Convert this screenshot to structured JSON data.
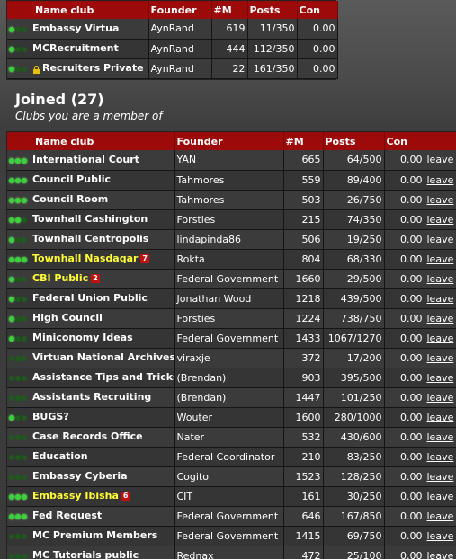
{
  "owned": {
    "headers": {
      "name": "Name club",
      "founder": "Founder",
      "members": "#M",
      "posts": "Posts",
      "con": "Con"
    },
    "rows": [
      {
        "dots": 3,
        "lit": 1,
        "name": "Embassy Virtua",
        "founder": "AynRand",
        "members": "619",
        "posts": "11/350",
        "con": "0.00",
        "lock": false
      },
      {
        "dots": 3,
        "lit": 1,
        "name": "MCRecruitment",
        "founder": "AynRand",
        "members": "444",
        "posts": "112/350",
        "con": "0.00",
        "lock": false
      },
      {
        "dots": 3,
        "lit": 1,
        "name": "Recruiters Private",
        "founder": "AynRand",
        "members": "22",
        "posts": "161/350",
        "con": "0.00",
        "lock": true
      }
    ]
  },
  "joined": {
    "title": "Joined (27)",
    "subtitle": "Clubs you are a member of",
    "headers": {
      "name": "Name club",
      "founder": "Founder",
      "members": "#M",
      "posts": "Posts",
      "con": "Con"
    },
    "leave_label": "leave",
    "rows": [
      {
        "lit": 3,
        "name": "International Court",
        "founder": "YAN",
        "members": "665",
        "posts": "64/500",
        "con": "0.00",
        "highlight": false,
        "badge": ""
      },
      {
        "lit": 3,
        "name": "Council Public",
        "founder": "Tahmores",
        "members": "559",
        "posts": "89/400",
        "con": "0.00",
        "highlight": false,
        "badge": ""
      },
      {
        "lit": 3,
        "name": "Council Room",
        "founder": "Tahmores",
        "members": "503",
        "posts": "26/750",
        "con": "0.00",
        "highlight": false,
        "badge": ""
      },
      {
        "lit": 2,
        "name": "Townhall Cashington",
        "founder": "Forsties",
        "members": "215",
        "posts": "74/350",
        "con": "0.00",
        "highlight": false,
        "badge": ""
      },
      {
        "lit": 1,
        "name": "Townhall Centropolis",
        "founder": "lindapinda86",
        "members": "506",
        "posts": "19/250",
        "con": "0.00",
        "highlight": false,
        "badge": ""
      },
      {
        "lit": 3,
        "name": "Townhall Nasdaqar",
        "founder": "Rokta",
        "members": "804",
        "posts": "68/330",
        "con": "0.00",
        "highlight": true,
        "badge": "7"
      },
      {
        "lit": 1,
        "name": "CBI Public",
        "founder": "Federal Government",
        "members": "1660",
        "posts": "29/500",
        "con": "0.00",
        "highlight": true,
        "badge": "2"
      },
      {
        "lit": 1,
        "name": "Federal Union Public",
        "founder": "Jonathan Wood",
        "members": "1218",
        "posts": "439/500",
        "con": "0.00",
        "highlight": false,
        "badge": ""
      },
      {
        "lit": 1,
        "name": "High Council",
        "founder": "Forsties",
        "members": "1224",
        "posts": "738/750",
        "con": "0.00",
        "highlight": false,
        "badge": ""
      },
      {
        "lit": 1,
        "name": "Miniconomy Ideas",
        "founder": "Federal Government",
        "members": "1433",
        "posts": "1067/1270",
        "con": "0.00",
        "highlight": false,
        "badge": ""
      },
      {
        "lit": 0,
        "name": "Virtuan National Archives",
        "founder": "viraxje",
        "members": "372",
        "posts": "17/200",
        "con": "0.00",
        "highlight": false,
        "badge": ""
      },
      {
        "lit": 0,
        "name": "Assistance Tips and Tricks",
        "founder": "(Brendan)",
        "members": "903",
        "posts": "395/500",
        "con": "0.00",
        "highlight": false,
        "badge": ""
      },
      {
        "lit": 0,
        "name": "Assistants Recruiting",
        "founder": "(Brendan)",
        "members": "1447",
        "posts": "101/250",
        "con": "0.00",
        "highlight": false,
        "badge": ""
      },
      {
        "lit": 1,
        "name": "BUGS?",
        "founder": "Wouter",
        "members": "1600",
        "posts": "280/1000",
        "con": "0.00",
        "highlight": false,
        "badge": ""
      },
      {
        "lit": 0,
        "name": "Case Records Office",
        "founder": "Nater",
        "members": "532",
        "posts": "430/600",
        "con": "0.00",
        "highlight": false,
        "badge": ""
      },
      {
        "lit": 0,
        "name": "Education",
        "founder": "Federal Coordinator",
        "members": "210",
        "posts": "83/250",
        "con": "0.00",
        "highlight": false,
        "badge": ""
      },
      {
        "lit": 0,
        "name": "Embassy Cyberia",
        "founder": "Cogito",
        "members": "1523",
        "posts": "128/250",
        "con": "0.00",
        "highlight": false,
        "badge": ""
      },
      {
        "lit": 3,
        "name": "Embassy Ibisha",
        "founder": "CIT",
        "members": "161",
        "posts": "30/250",
        "con": "0.00",
        "highlight": true,
        "badge": "6"
      },
      {
        "lit": 3,
        "name": "Fed Request",
        "founder": "Federal Government",
        "members": "646",
        "posts": "167/850",
        "con": "0.00",
        "highlight": false,
        "badge": ""
      },
      {
        "lit": 0,
        "name": "MC Premium Members",
        "founder": "Federal Government",
        "members": "1415",
        "posts": "69/750",
        "con": "0.00",
        "highlight": false,
        "badge": ""
      },
      {
        "lit": 0,
        "name": "MC Tutorials public",
        "founder": "Rednax",
        "members": "472",
        "posts": "25/100",
        "con": "0.00",
        "highlight": false,
        "badge": ""
      }
    ]
  },
  "colors": {
    "header_red": "#9d0a0a",
    "highlight_yellow": "#ffff33",
    "dot_on": "#3ad23a",
    "dot_off": "#1d5a1d",
    "badge_red": "#c01010"
  }
}
